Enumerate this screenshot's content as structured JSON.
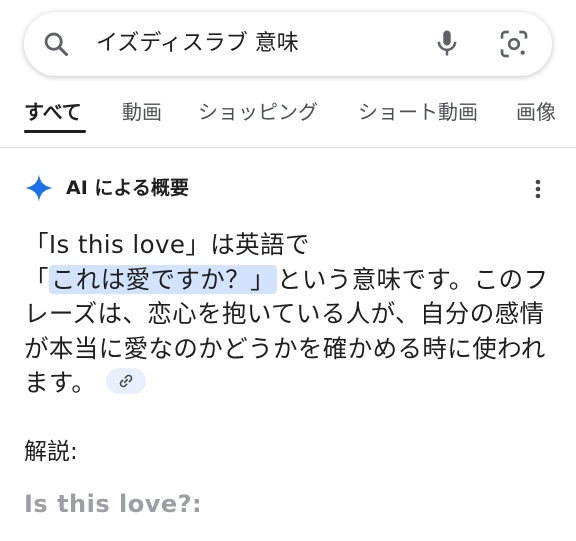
{
  "search": {
    "query": "イズディスラブ 意味",
    "icons": [
      "search-icon",
      "microphone-icon",
      "google-lens-icon"
    ]
  },
  "tabs": [
    {
      "label": "すべて",
      "active": true
    },
    {
      "label": "動画"
    },
    {
      "label": "ショッピング"
    },
    {
      "label": "ショート動画"
    },
    {
      "label": "画像"
    }
  ],
  "ai_overview": {
    "title": "AI による概要",
    "answer": {
      "part1": "「Is this love」は英語で「",
      "highlight": "これは愛ですか？」",
      "part2": "という意味です。このフレーズは、恋心を抱いている人が、自分の感情が本当に愛なのかどうかを確かめる時に使われます。"
    },
    "section_title": "解説:",
    "subheading": "Is this love?:"
  },
  "colors": {
    "highlight": "#d3e3fd",
    "link_chip": "#e8f0fe",
    "sparkle": "#1a73e8"
  }
}
